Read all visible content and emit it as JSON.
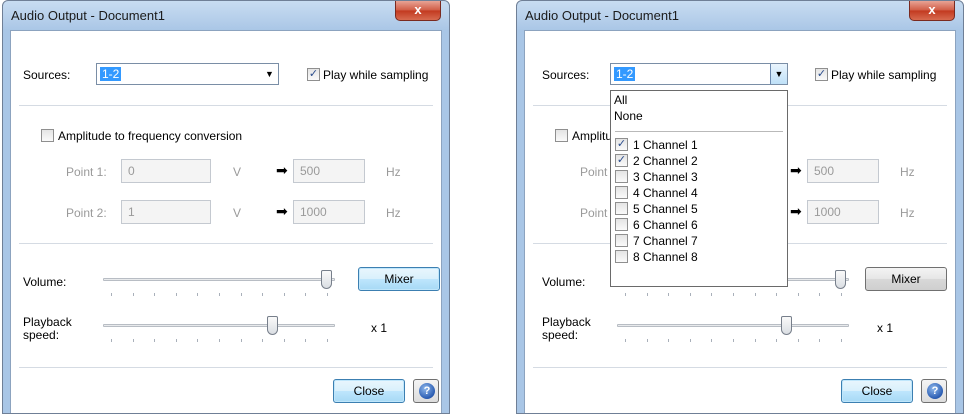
{
  "left": {
    "title": "Audio Output - Document1",
    "close_x": "x",
    "sources_label": "Sources:",
    "sources_value": "1-2",
    "play_label": "Play while sampling",
    "play_checked": "✓",
    "amp_label": "Amplitude to frequency conversion",
    "point1_label": "Point 1:",
    "point1_value": "0",
    "point1_unit": "V",
    "point1_freq": "500",
    "point1_freq_unit": "Hz",
    "point2_label": "Point 2:",
    "point2_value": "1",
    "point2_unit": "V",
    "point2_freq": "1000",
    "point2_freq_unit": "Hz",
    "volume_label": "Volume:",
    "volume_level": 1.0,
    "mixer_label": "Mixer",
    "speed_label_line1": "Playback",
    "speed_label_line2": "speed:",
    "speed_level": 0.75,
    "speed_value": "x 1",
    "close_label": "Close",
    "help_label": "?"
  },
  "right": {
    "title": "Audio Output - Document1",
    "close_x": "x",
    "sources_label": "Sources:",
    "sources_value": "1-2",
    "play_label": "Play while sampling",
    "play_checked": "✓",
    "amp_label": "Amplitu",
    "point1_label": "Point",
    "point1_freq": "500",
    "point1_freq_unit": "Hz",
    "point2_label": "Point",
    "point2_freq": "1000",
    "point2_freq_unit": "Hz",
    "volume_label": "Volume:",
    "volume_level": 1.0,
    "mixer_label": "Mixer",
    "speed_label_line1": "Playback",
    "speed_label_line2": "speed:",
    "speed_level": 0.75,
    "speed_value": "x 1",
    "close_label": "Close",
    "help_label": "?",
    "dropdown": {
      "all": "All",
      "none": "None",
      "channels": [
        {
          "label": "1 Channel 1",
          "checked": true
        },
        {
          "label": "2 Channel 2",
          "checked": true
        },
        {
          "label": "3 Channel 3",
          "checked": false
        },
        {
          "label": "4 Channel 4",
          "checked": false
        },
        {
          "label": "5 Channel 5",
          "checked": false
        },
        {
          "label": "6 Channel 6",
          "checked": false
        },
        {
          "label": "7 Channel 7",
          "checked": false
        },
        {
          "label": "8 Channel 8",
          "checked": false
        }
      ]
    }
  }
}
